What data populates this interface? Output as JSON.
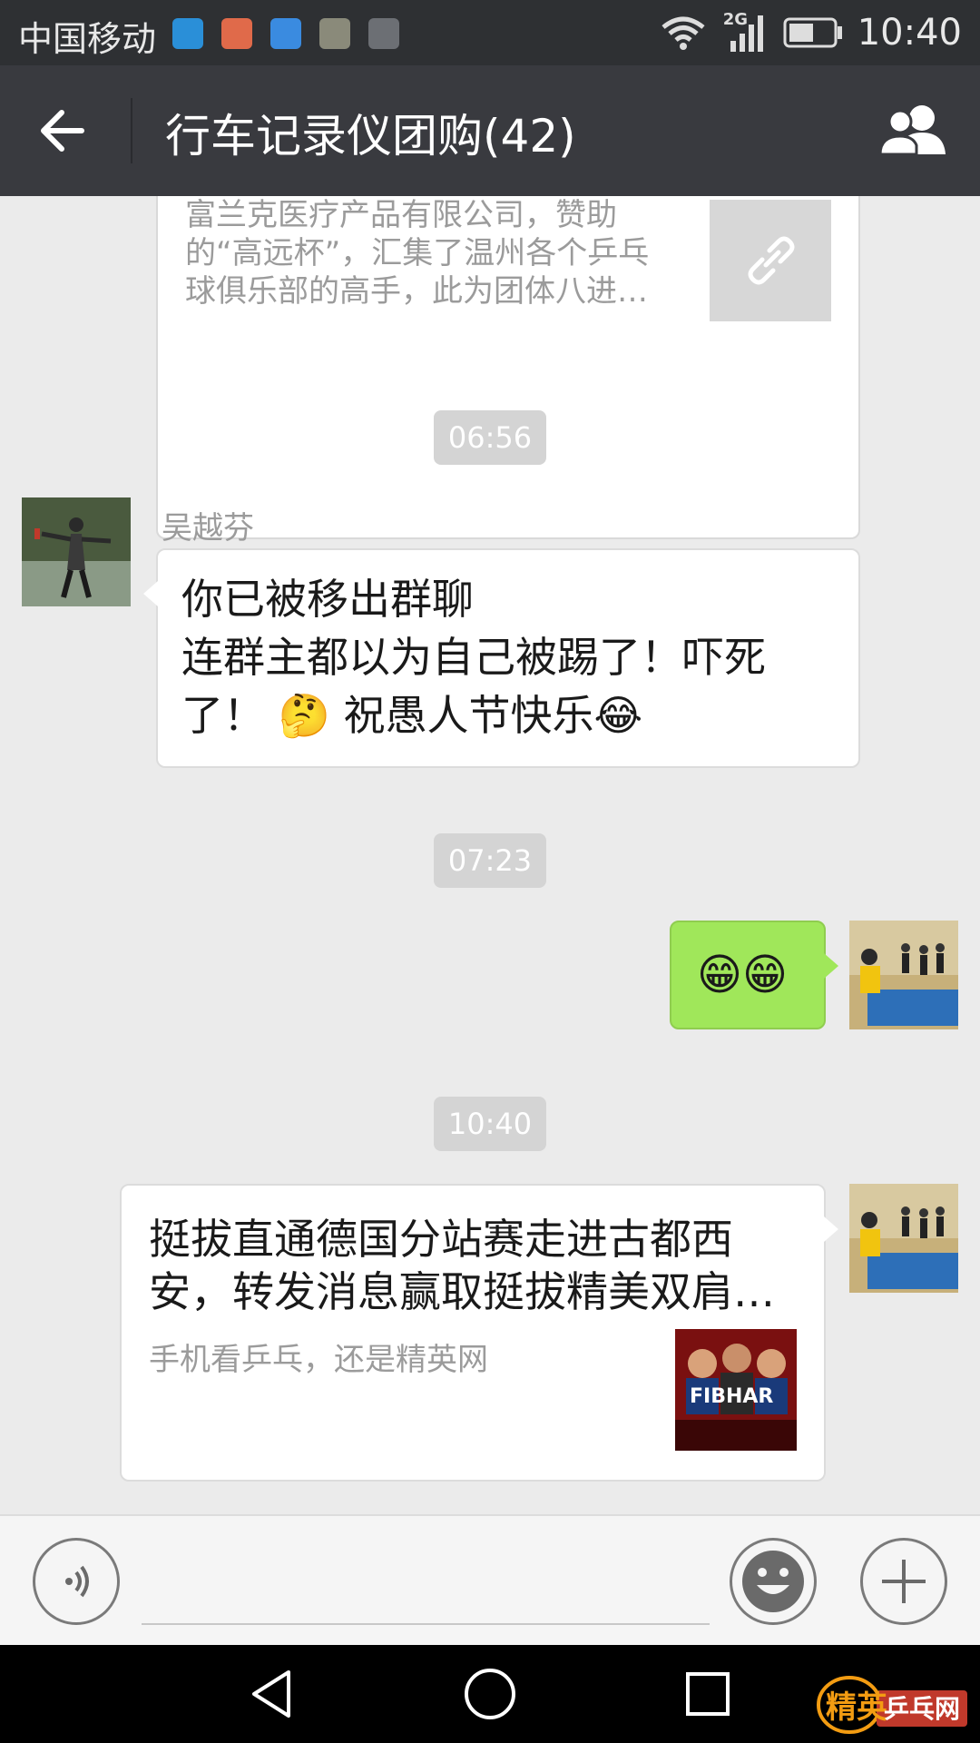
{
  "status_bar": {
    "carrier": "中国移动",
    "network": "2G",
    "time": "10:40",
    "icons": [
      "app-notif-icon",
      "mail-notif-icon",
      "health-notif-icon",
      "gallery-notif-icon",
      "image-notif-icon",
      "wifi-icon",
      "signal-icon",
      "battery-icon"
    ]
  },
  "header": {
    "title": "行车记录仪团购(42)",
    "back_icon": "back-arrow-icon",
    "members_icon": "group-members-icon"
  },
  "chat": {
    "link_card": {
      "description": "富兰克医疗产品有限公司，赞助的“高远杯”，汇集了温州各个乒乓球俱乐部的高手，此为团体八进…",
      "thumb_icon": "link-icon"
    },
    "timestamps": [
      "06:56",
      "07:23",
      "10:40"
    ],
    "message_1": {
      "sender": "吴越芬",
      "lines": [
        "你已被移出群聊",
        "连群主都以为自己被踢了！吓死",
        "了！ 🤔 祝愚人节快乐😂"
      ]
    },
    "message_2": {
      "text": "😁😁"
    },
    "message_3": {
      "title": "挺拔直通德国分站赛走进古都西安，转发消息赢取挺拔精美双肩…",
      "description": "手机看乒乓，还是精英网",
      "thumb_label": "FIBHAR"
    }
  },
  "input_bar": {
    "voice_icon": "voice-icon",
    "emoji_icon": "emoji-icon",
    "plus_icon": "plus-icon"
  },
  "nav_bar": {
    "icons": [
      "nav-back-icon",
      "nav-home-icon",
      "nav-recents-icon"
    ],
    "watermark_logo_text": "精英乒乓网"
  },
  "colors": {
    "title_bar": "#393a3f",
    "status_bar": "#2e3033",
    "chat_bg": "#ebebeb",
    "outgoing_bubble": "#a0e75a"
  }
}
